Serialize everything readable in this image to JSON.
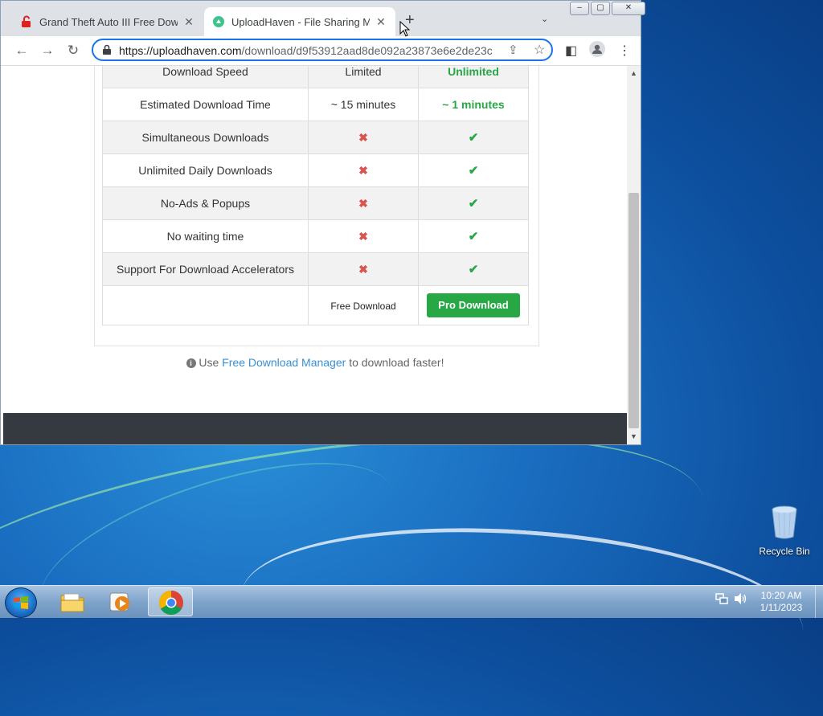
{
  "browser": {
    "tabs": [
      {
        "title": "Grand Theft Auto III Free Downlo",
        "close": "✕"
      },
      {
        "title": "UploadHaven - File Sharing Made",
        "close": "✕"
      }
    ],
    "new_tab": "+",
    "tab_menu": "⌄",
    "url_host": "https://uploadhaven.com",
    "url_path": "/download/d9f53912aad8de092a23873e6e2de23c",
    "window_controls": {
      "minimize": "–",
      "maximize": "▢",
      "close": "✕"
    }
  },
  "comparison": {
    "rows": [
      {
        "feature": "Download Speed",
        "free": "Limited",
        "pro": "Unlimited",
        "type": "text"
      },
      {
        "feature": "Estimated Download Time",
        "free": "~ 15 minutes",
        "pro": "~ 1 minutes",
        "type": "text"
      },
      {
        "feature": "Simultaneous Downloads",
        "free": "✖",
        "pro": "✔",
        "type": "mark"
      },
      {
        "feature": "Unlimited Daily Downloads",
        "free": "✖",
        "pro": "✔",
        "type": "mark"
      },
      {
        "feature": "No-Ads & Popups",
        "free": "✖",
        "pro": "✔",
        "type": "mark"
      },
      {
        "feature": "No waiting time",
        "free": "✖",
        "pro": "✔",
        "type": "mark"
      },
      {
        "feature": "Support For Download Accelerators",
        "free": "✖",
        "pro": "✔",
        "type": "mark"
      }
    ],
    "free_download_label": "Free Download",
    "pro_download_label": "Pro Download"
  },
  "hint": {
    "info_icon": "i",
    "prefix": "Use",
    "link": "Free Download Manager",
    "suffix": "to download faster!"
  },
  "desktop": {
    "recycle_bin": "Recycle Bin"
  },
  "taskbar": {
    "time": "10:20 AM",
    "date": "1/11/2023"
  },
  "colors": {
    "accent_green": "#28a745",
    "x_red": "#d9534f",
    "link_blue": "#3a8fd0"
  }
}
